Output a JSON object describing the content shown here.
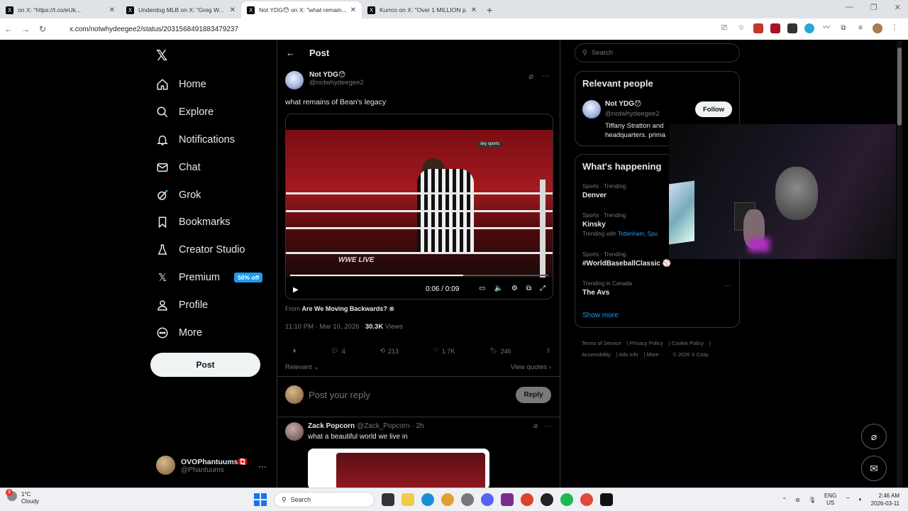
{
  "browser": {
    "tabs": [
      {
        "title": "on X: \"https://t.co/eUk...",
        "active": false
      },
      {
        "title": "Underdog MLB on X: \"Greg W...",
        "active": false
      },
      {
        "title": "Not YDG😯 on X: \"what remain...",
        "active": true
      },
      {
        "title": "Kurrco on X: \"Over 1 MILLION p...",
        "active": false
      }
    ],
    "url": "x.com/notwhydeegee2/status/2031568491883479237"
  },
  "nav": {
    "logo": "𝕏",
    "items": [
      {
        "label": "Home",
        "icon": "home-icon"
      },
      {
        "label": "Explore",
        "icon": "search-icon"
      },
      {
        "label": "Notifications",
        "icon": "bell-icon"
      },
      {
        "label": "Chat",
        "icon": "mail-icon"
      },
      {
        "label": "Grok",
        "icon": "grok-icon"
      },
      {
        "label": "Bookmarks",
        "icon": "bookmark-icon"
      },
      {
        "label": "Creator Studio",
        "icon": "creator-icon"
      },
      {
        "label": "Premium",
        "icon": "x-icon",
        "badge": "50% off"
      },
      {
        "label": "Profile",
        "icon": "person-icon"
      },
      {
        "label": "More",
        "icon": "more-icon"
      }
    ],
    "post_label": "Post",
    "account": {
      "name": "OVOPhantuums🇨🇦",
      "handle": "@Phantuums"
    }
  },
  "header": {
    "title": "Post"
  },
  "tweet": {
    "name": "Not YDG😯",
    "handle": "@notwhydeegee2",
    "text": "what remains of Bean's legacy",
    "video": {
      "time": "0:06 / 0:09",
      "progress": 0.67,
      "overlay_brand": "WWE LIVE",
      "corner_brand": "sky sports"
    },
    "from_label": "From",
    "from_source": "Are We Moving Backwards? ⊗",
    "timestamp": "11:10 PM · Mar 10, 2026 ·",
    "views_count": "30.3K",
    "views_label": "Views",
    "stats": {
      "replies": "4",
      "reposts": "213",
      "likes": "1.7K",
      "bookmarks": "246"
    },
    "relevant_label": "Relevant",
    "view_quotes_label": "View quotes"
  },
  "reply_box": {
    "placeholder": "Post your reply",
    "button": "Reply"
  },
  "reply": {
    "name": "Zack Popcorn",
    "handle": "@Zack_Popcorn · 2h",
    "text": "what a beautiful world we live in"
  },
  "right": {
    "search_placeholder": "Search",
    "relevant_people_title": "Relevant people",
    "person": {
      "name": "Not YDG😯",
      "handle": "@notwhydeegee2",
      "bio": "Tiffany Stratton and headquarters. prima",
      "follow_label": "Follow"
    },
    "happening_title": "What's happening",
    "trends": [
      {
        "context": "Sports · Trending",
        "name": "Denver",
        "with": ""
      },
      {
        "context": "Sports · Trending",
        "name": "Kinsky",
        "with": "Trending with",
        "with_links": "Tottenham, Spu"
      },
      {
        "context": "Sports · Trending",
        "name": "#WorldBaseballClassic ⚾",
        "with": ""
      },
      {
        "context": "Trending in Canada",
        "name": "The Avs",
        "with": ""
      }
    ],
    "show_more": "Show more",
    "footer_links": [
      "Terms of Service",
      "Privacy Policy",
      "Cookie Policy",
      "Accessibility",
      "Ads info",
      "More ···",
      "© 2026 X Corp."
    ]
  },
  "taskbar": {
    "weather_temp": "1°C",
    "weather_desc": "Cloudy",
    "weather_badge": "1",
    "search_label": "Search",
    "lang": "ENG",
    "region": "US",
    "time": "2:46 AM",
    "date": "2026-03-11"
  }
}
